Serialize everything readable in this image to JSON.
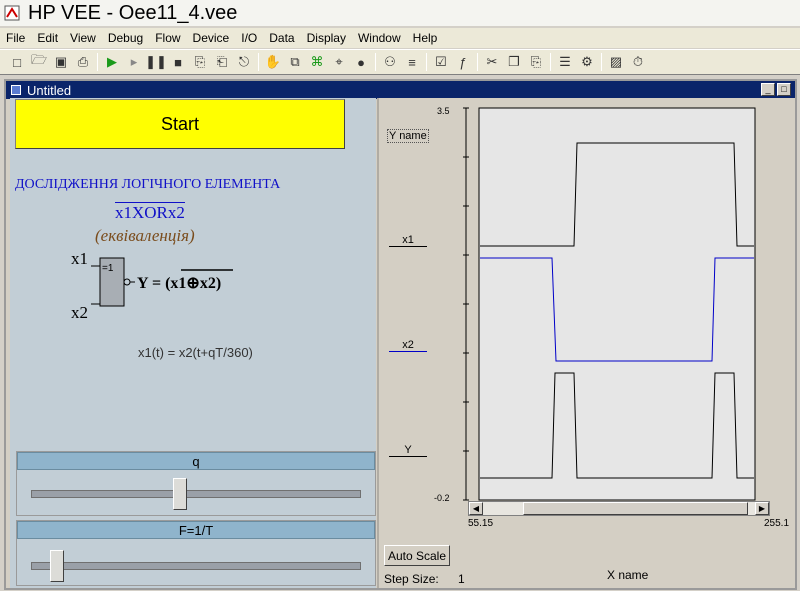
{
  "app": {
    "title": "HP VEE - Oee11_4.vee"
  },
  "menu": [
    "File",
    "Edit",
    "View",
    "Debug",
    "Flow",
    "Device",
    "I/O",
    "Data",
    "Display",
    "Window",
    "Help"
  ],
  "window": {
    "title": "Untitled"
  },
  "start_button": {
    "label": "Start"
  },
  "panel": {
    "heading": "ДОСЛІДЖЕННЯ ЛОГІЧНОГО ЕЛЕМЕНТА",
    "formula": "x1XORx2",
    "subtitle": "(еквіваленція)",
    "gate": {
      "input1": "x1",
      "input2": "x2",
      "symbol": "=1",
      "output": "Y = (x1⊕x2)"
    },
    "caption": "x1(t) = x2(t+qT/360)"
  },
  "slider_q": {
    "label": "q",
    "value_fraction": 0.45
  },
  "slider_f": {
    "label": "F=1/T",
    "value_fraction": 0.06
  },
  "graph": {
    "y_max": "3.5",
    "y_min": "-0.2",
    "y_name": "Y name",
    "x_name": "X name",
    "x_min": "55.15",
    "x_max": "255.1",
    "traces": [
      "x1",
      "x2",
      "Y"
    ],
    "auto_scale_label": "Auto Scale",
    "step_size_label": "Step Size:",
    "step_size_value": "1",
    "colors": {
      "trace_black": "#000000",
      "trace_blue": "#0000c8",
      "plot_bg": "#e6e6e6"
    }
  }
}
